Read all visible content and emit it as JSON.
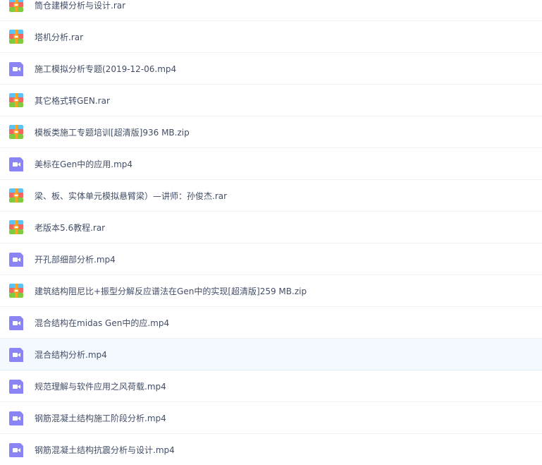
{
  "files": [
    {
      "name": "筒仓建模分析与设计.rar",
      "type": "archive"
    },
    {
      "name": "塔机分析.rar",
      "type": "archive"
    },
    {
      "name": "施工模拟分析专题(2019-12-06.mp4",
      "type": "video"
    },
    {
      "name": "其它格式转GEN.rar",
      "type": "archive"
    },
    {
      "name": "模板类施工专题培训[超清版]936 MB.zip",
      "type": "archive"
    },
    {
      "name": "美标在Gen中的应用.mp4",
      "type": "video"
    },
    {
      "name": "梁、板、实体单元模拟悬臂梁）—讲师：孙俊杰.rar",
      "type": "archive"
    },
    {
      "name": "老版本5.6教程.rar",
      "type": "archive"
    },
    {
      "name": "开孔部细部分析.mp4",
      "type": "video"
    },
    {
      "name": "建筑结构阻尼比+振型分解反应谱法在Gen中的实现[超清版]259 MB.zip",
      "type": "archive"
    },
    {
      "name": "混合结构在midas Gen中的应.mp4",
      "type": "video"
    },
    {
      "name": "混合结构分析.mp4",
      "type": "video",
      "selected": true
    },
    {
      "name": "规范理解与软件应用之风荷载.mp4",
      "type": "video"
    },
    {
      "name": "钢筋混凝土结构施工阶段分析.mp4",
      "type": "video"
    },
    {
      "name": "钢筋混凝土结构抗震分析与设计.mp4",
      "type": "video"
    }
  ],
  "colors": {
    "video": "#8b84f5",
    "text": "#424e67",
    "selected_bg": "#f4f9ff"
  }
}
